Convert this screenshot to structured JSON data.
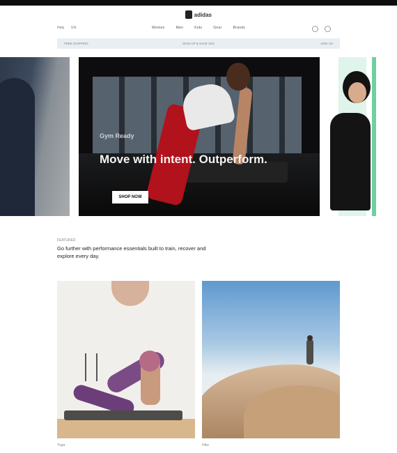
{
  "header": {
    "logo_text": "adidas",
    "util_left": [
      "Help",
      "EN"
    ],
    "nav": [
      "Women",
      "Men",
      "Kids",
      "Gear",
      "Brands"
    ],
    "util_right": [
      "Search",
      "Cart"
    ]
  },
  "promo": {
    "left": "FREE SHIPPING",
    "center": "SIGN UP & SAVE 15%",
    "right": "JOIN US"
  },
  "carousel": {
    "main": {
      "kicker": "Gym Ready",
      "title": "Move with intent. Outperform.",
      "cta": "SHOP NOW"
    }
  },
  "feature": {
    "kicker": "FEATURED",
    "headline": "Go further with performance essentials built to train, recover and explore every day."
  },
  "cards": [
    {
      "caption": "Yoga"
    },
    {
      "caption": "Hike"
    }
  ],
  "colors": {
    "topbar": "#0e0e0e",
    "promo_bg": "#e8eef1",
    "accent_red": "#b1121b"
  }
}
